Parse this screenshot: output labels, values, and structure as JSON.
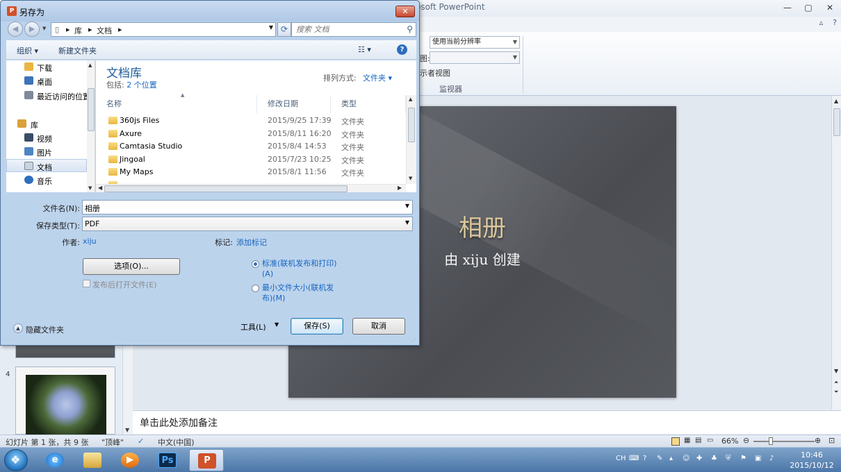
{
  "powerpoint": {
    "title_fragment": "osoft PowerPoint",
    "window_controls": [
      "—",
      "▢",
      "✕"
    ],
    "help_icons": [
      "▵",
      "?"
    ],
    "ribbon": {
      "resolution_select": "使用当前分辨率",
      "blank_select": "",
      "blank_label": "图:",
      "presenter_view": "示者视图",
      "group_label": "监视器"
    },
    "thumbnail_number": "4",
    "slide": {
      "title": "相册",
      "subtitle": "由 xiju 创建"
    },
    "notes_placeholder": "单击此处添加备注",
    "statusbar": {
      "slide_info": "幻灯片 第 1 张，共 9 张",
      "theme": "\"顶峰\"",
      "language": "中文(中国)",
      "zoom": "66%"
    }
  },
  "taskbar": {
    "apps": [
      "internet-explorer",
      "windows-explorer",
      "media-player",
      "photoshop",
      "powerpoint"
    ],
    "ps_label": "Ps",
    "tray_lang": "CH",
    "clock_time": "10:46",
    "clock_date": "2015/10/12"
  },
  "dialog": {
    "title": "另存为",
    "close": "✕",
    "breadcrumb": [
      "库",
      "文档"
    ],
    "search_placeholder": "搜索 文档",
    "toolbar": {
      "organize": "组织 ▾",
      "new_folder": "新建文件夹",
      "view": "☷ ▾",
      "help": "?"
    },
    "nav_items": [
      {
        "label": "下载",
        "icon": "download-folder-icon",
        "color": "#e9b640"
      },
      {
        "label": "桌面",
        "icon": "desktop-icon",
        "color": "#3d73b8"
      },
      {
        "label": "最近访问的位置",
        "icon": "recent-places-icon",
        "color": "#7d8a99"
      },
      {
        "label": "库",
        "icon": "libraries-icon",
        "color": "#d9a23a"
      },
      {
        "label": "视频",
        "icon": "videos-icon",
        "color": "#3a4d68"
      },
      {
        "label": "图片",
        "icon": "pictures-icon",
        "color": "#4f84c2"
      },
      {
        "label": "文档",
        "icon": "documents-icon",
        "color": "#c9d3e0"
      },
      {
        "label": "音乐",
        "icon": "music-icon",
        "color": "#2d6fbf"
      }
    ],
    "library": {
      "title": "文档库",
      "includes_prefix": "包括: ",
      "includes_link": "2 个位置",
      "sort_label": "排列方式:",
      "sort_value": "文件夹 ▾"
    },
    "columns": [
      "名称",
      "修改日期",
      "类型"
    ],
    "files": [
      {
        "name": "360js Files",
        "date": "2015/9/25 17:39",
        "type": "文件夹"
      },
      {
        "name": "Axure",
        "date": "2015/8/11 16:20",
        "type": "文件夹"
      },
      {
        "name": "Camtasia Studio",
        "date": "2015/8/4 14:53",
        "type": "文件夹"
      },
      {
        "name": "Jingoal",
        "date": "2015/7/23 10:25",
        "type": "文件夹"
      },
      {
        "name": "My Maps",
        "date": "2015/8/1 11:56",
        "type": "文件夹"
      }
    ],
    "form": {
      "filename_label": "文件名(N):",
      "filename_value": "相册",
      "filetype_label": "保存类型(T):",
      "filetype_value": "PDF",
      "author_label": "作者:",
      "author_value": "xiju",
      "tags_label": "标记:",
      "tags_value": "添加标记",
      "options_button": "选项(O)...",
      "open_after_publish": "发布后打开文件(E)",
      "optimize_standard": "标准(联机发布和打印)(A)",
      "optimize_minimum": "最小文件大小(联机发布)(M)",
      "hide_folders": "隐藏文件夹",
      "tools": "工具(L)",
      "save": "保存(S)",
      "cancel": "取消"
    }
  }
}
